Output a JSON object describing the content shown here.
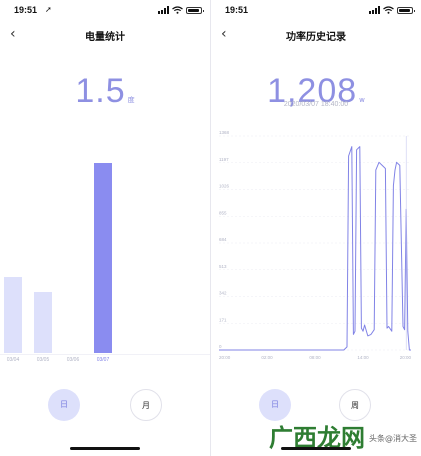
{
  "colors": {
    "accent": "#8e90e2",
    "bar_selected": "#8a8cf0",
    "bar_light": "#dde0fb",
    "button_active_bg": "#dde0fb"
  },
  "left": {
    "status": {
      "time": "19:51",
      "location_glyph": "➚"
    },
    "title": "电量统计",
    "value": "1.5",
    "unit": "度",
    "chart_data": {
      "type": "bar",
      "categories": [
        "03/04",
        "03/05",
        "03/06",
        "03/07"
      ],
      "values": [
        0.6,
        0.48,
        0,
        1.5
      ],
      "selected": "03/07"
    },
    "buttons": {
      "day": "日",
      "month": "月"
    }
  },
  "right": {
    "status": {
      "time": "19:51"
    },
    "title": "功率历史记录",
    "value": "1,208",
    "unit": "w",
    "timestamp": "2020/03/07 18:40:00",
    "chart_data": {
      "type": "line",
      "yticks": [
        "1368",
        "1197",
        "1026",
        "855",
        "684",
        "513",
        "342",
        "171",
        "0"
      ],
      "xticks": [
        "20:00",
        "02:00",
        "08:00",
        "14:00",
        "20:00"
      ],
      "ylim": [
        0,
        1368
      ],
      "x": [
        0,
        7.8,
        8.0,
        8.1,
        8.3,
        8.4,
        8.5,
        8.6,
        8.8,
        8.9,
        9.0,
        9.1,
        9.3,
        9.5,
        9.7,
        9.8,
        10.0,
        10.2,
        10.4,
        10.5,
        10.6,
        10.8,
        10.9,
        11.0,
        11.1,
        11.3,
        11.5,
        11.6,
        11.7,
        11.8,
        11.9,
        12.0
      ],
      "y": [
        0,
        0,
        20,
        1240,
        1300,
        100,
        120,
        1280,
        1300,
        140,
        120,
        160,
        90,
        100,
        130,
        1150,
        1200,
        1180,
        1160,
        140,
        150,
        120,
        1050,
        1150,
        1200,
        1180,
        150,
        130,
        900,
        120,
        0,
        0
      ],
      "series": [
        {
          "name": "",
          "color": "#8183e6"
        }
      ]
    },
    "buttons": {
      "day": "日",
      "week": "周"
    }
  },
  "watermark": {
    "logo": "广西龙网",
    "sub": "头条@消大圣"
  }
}
